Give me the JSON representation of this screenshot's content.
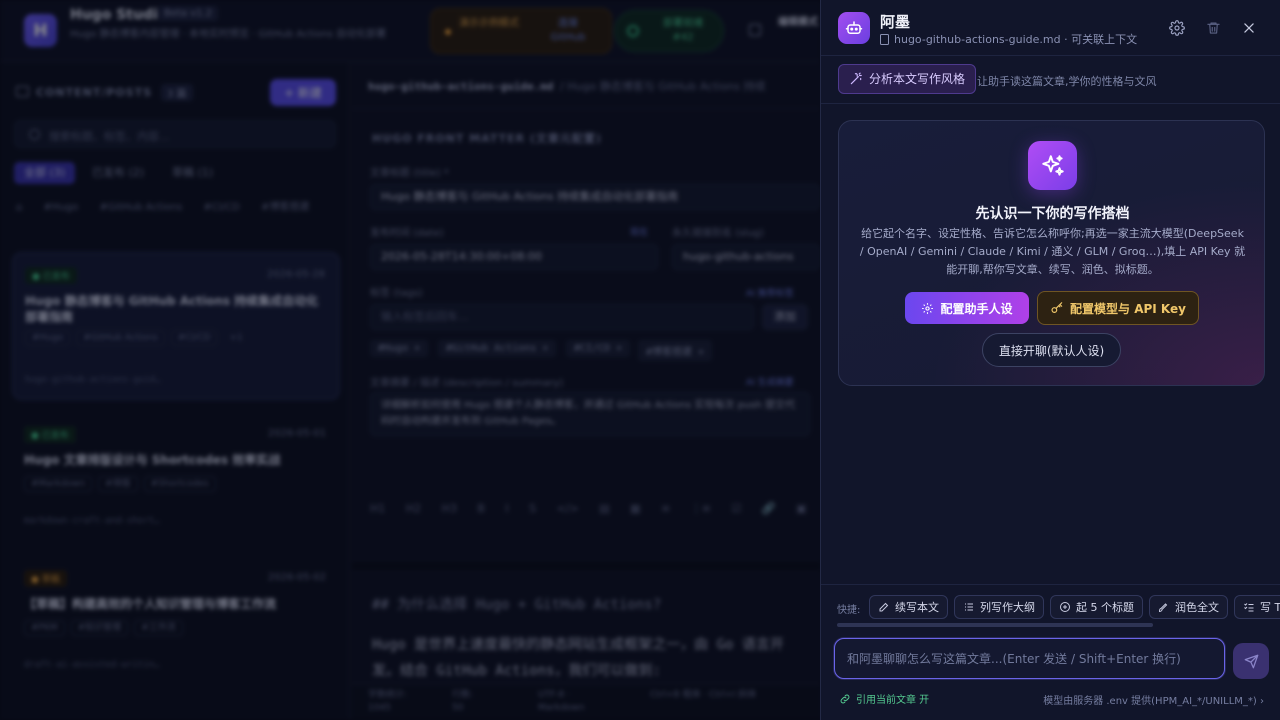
{
  "app": {
    "name": "Hugo Studio",
    "version": "Beta v1.2",
    "subtitle": "Hugo 静态博客内容管理 · 本地实时预览 · GitHub Actions 自动化部署",
    "demo_label": "演示示例模式",
    "demo_link": "连接 GitHub",
    "deploy_label": "部署就绪 #42",
    "mode_label": "编辑模式"
  },
  "sidebar": {
    "title": "CONTENT/POSTS",
    "count": "3 篇",
    "new_label": "+ 新建",
    "search_placeholder": "搜索标题、标签、内容...",
    "filters": [
      "全部 (3)",
      "已发布 (2)",
      "草稿 (1)"
    ],
    "tags": [
      "#Hugo",
      "#GitHub Actions",
      "#CI/CD",
      "#博客搭建"
    ],
    "posts": [
      {
        "status": "● 已发布",
        "date": "2026-05-28",
        "title": "Hugo 静态博客与 GitHub Actions 持续集成自动化部署指南",
        "tags": [
          "#Hugo",
          "#GitHub Actions",
          "#CI/CD",
          "+1"
        ],
        "slug": "hugo-github-actions-guid…"
      },
      {
        "status": "● 已发布",
        "date": "2026-05-01",
        "title": "Hugo 文章排版设计与 Shortcodes 效率实战",
        "tags": [
          "#Markdown",
          "#排版",
          "#Shortcodes"
        ],
        "slug": "markdown-craft-and-short…"
      },
      {
        "status": "● 草稿",
        "date": "2026-05-02",
        "title": "【草稿】构建高效的个人知识管理与博客工作流",
        "tags": [
          "#PKM",
          "#知识管理",
          "#工作流"
        ],
        "slug": "draft-ai-assisted-writin…"
      }
    ]
  },
  "editor": {
    "filename": "hugo-github-actions-guide.md",
    "crumb": "/ Hugo 静态博客与 GitHub Actions 持续",
    "fm_title": "HUGO FRONT MATTER (文章元配置)",
    "title_label": "文章标题 (title) *",
    "title_value": "Hugo 静态博客与 GitHub Actions 持续集成自动化部署指南",
    "date_label": "发布时间 (date)",
    "date_link": "现在",
    "date_value": "2026-05-28T14:30:00+08:00",
    "slug_label": "永久链接别名 (slug)",
    "slug_value": "hugo-github-actions",
    "tags_label": "标签 (tags)",
    "tags_link": "AI 推荐标签",
    "tags_placeholder": "输入标签后回车...",
    "tags_add": "添加",
    "tag_chips": [
      "#Hugo ×",
      "#GitHub Actions ×",
      "#CI/CD ×",
      "#博客搭建 ×"
    ],
    "desc_label": "文章摘要 / 描述 (description / summary)",
    "desc_link": "AI 生成摘要",
    "desc_value": "详细解析如何使用 Hugo 搭建个人静态博客，并通过 GitHub Actions 实现每次 push 提交代码时自动构建并发布到 GitHub Pages。",
    "toolbar": [
      "H1",
      "H2",
      "H3",
      "B",
      "I",
      "S",
      "</>",
      "▤",
      "▦",
      "≡",
      "⋮≡",
      "☑",
      "🔗",
      "▣"
    ],
    "md_heading": "## 为什么选择 Hugo + GitHub Actions?",
    "md_line1": "Hugo 是世界上速度最快的静态网站生成框架之一，由 Go 语言开",
    "md_line2": "发。结合 GitHub Actions，我们可以做到:",
    "status": {
      "words_label": "字数统计:",
      "words": "1045",
      "lines_label": "行数:",
      "lines": "50",
      "encoding": "UTF-8 · Markdown",
      "shortcut": "Ctrl+B 粗体 · Ctrl+I 斜体"
    }
  },
  "drawer": {
    "bot_name": "阿墨",
    "bot_sub": "hugo-github-actions-guide.md · 可关联上下文",
    "analyze_label": "分析本文写作风格",
    "analyze_hint": "让助手读这篇文章,学你的性格与文风",
    "welcome_title": "先认识一下你的写作搭档",
    "welcome_desc": "给它起个名字、设定性格、告诉它怎么称呼你;再选一家主流大模型(DeepSeek / OpenAI / Gemini / Claude / Kimi / 通义 / GLM / Groq…),填上 API Key 就能开聊,帮你写文章、续写、润色、拟标题。",
    "btn_persona": "配置助手人设",
    "btn_model": "配置模型与 API Key",
    "btn_direct": "直接开聊(默认人设)",
    "quick_label": "快捷:",
    "quick_actions": [
      "续写本文",
      "列写作大纲",
      "起 5 个标题",
      "润色全文",
      "写 TL;DR"
    ],
    "input_placeholder": "和阿墨聊聊怎么写这篇文章...(Enter 发送 / Shift+Enter 换行)",
    "foot_left": "引用当前文章 开",
    "foot_right": "模型由服务器 .env 提供(HPM_AI_*/UNILLM_*)",
    "accent": "#6a64e8"
  }
}
